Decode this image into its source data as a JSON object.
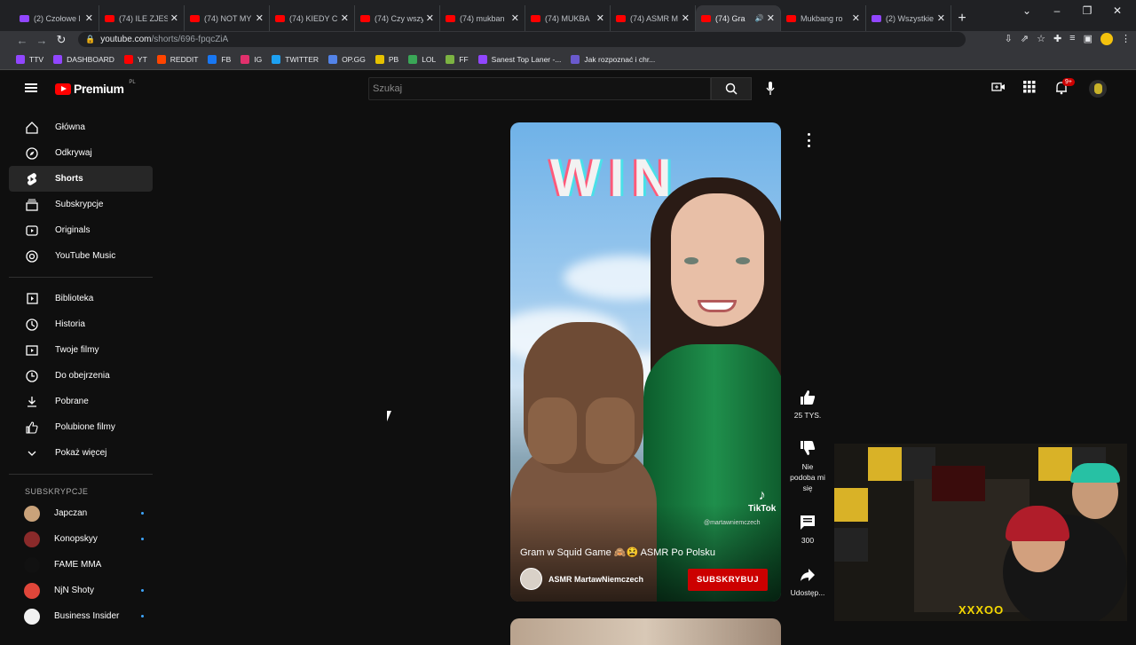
{
  "browser": {
    "tabs": [
      {
        "title": "(2) Czołowe l",
        "type": "tw"
      },
      {
        "title": "(74) ILE ZJESZ",
        "type": "yt"
      },
      {
        "title": "(74) NOT MY",
        "type": "yt"
      },
      {
        "title": "(74) KIEDY C",
        "type": "yt"
      },
      {
        "title": "(74) Czy wszy",
        "type": "yt"
      },
      {
        "title": "(74) mukban",
        "type": "yt"
      },
      {
        "title": "(74) MUKBA",
        "type": "yt"
      },
      {
        "title": "(74) ASMR M",
        "type": "yt"
      },
      {
        "title": "(74) Gra",
        "type": "yt",
        "active": true
      },
      {
        "title": "Mukbang ro",
        "type": "yt"
      },
      {
        "title": "(2) Wszystkie",
        "type": "tw"
      }
    ],
    "url_domain": "youtube.com",
    "url_path": "/shorts/696-fpqcZiA",
    "bookmarks": [
      {
        "label": "TTV",
        "color": "#9146ff"
      },
      {
        "label": "DASHBOARD",
        "color": "#9146ff"
      },
      {
        "label": "YT",
        "color": "#ff0000"
      },
      {
        "label": "REDDIT",
        "color": "#ff4500"
      },
      {
        "label": "FB",
        "color": "#1877f2"
      },
      {
        "label": "IG",
        "color": "#e1306c"
      },
      {
        "label": "TWITTER",
        "color": "#1da1f2"
      },
      {
        "label": "OP.GG",
        "color": "#5383e8"
      },
      {
        "label": "PB",
        "color": "#e6c200"
      },
      {
        "label": "LOL",
        "color": "#3aa757"
      },
      {
        "label": "FF",
        "color": "#7cb342"
      },
      {
        "label": "Sanest Top Laner -...",
        "color": "#9146ff"
      },
      {
        "label": "Jak rozpoznać i chr...",
        "color": "#6a5acd"
      }
    ]
  },
  "header": {
    "logo_text": "Premium",
    "logo_region": "PL",
    "search_placeholder": "Szukaj",
    "notif_count": "9+"
  },
  "sidebar": {
    "items": [
      {
        "label": "Główna",
        "icon": "home-icon"
      },
      {
        "label": "Odkrywaj",
        "icon": "compass-icon"
      },
      {
        "label": "Shorts",
        "icon": "shorts-icon",
        "active": true
      },
      {
        "label": "Subskrypcje",
        "icon": "subscriptions-icon"
      },
      {
        "label": "Originals",
        "icon": "originals-icon"
      },
      {
        "label": "YouTube Music",
        "icon": "music-icon"
      }
    ],
    "library": [
      {
        "label": "Biblioteka",
        "icon": "library-icon"
      },
      {
        "label": "Historia",
        "icon": "history-icon"
      },
      {
        "label": "Twoje filmy",
        "icon": "your-videos-icon"
      },
      {
        "label": "Do obejrzenia",
        "icon": "watch-later-icon"
      },
      {
        "label": "Pobrane",
        "icon": "download-icon"
      },
      {
        "label": "Polubione filmy",
        "icon": "like-icon"
      },
      {
        "label": "Pokaż więcej",
        "icon": "chevron-down-icon"
      }
    ],
    "subs_heading": "SUBSKRYPCJE",
    "subscriptions": [
      {
        "label": "Japczan",
        "color": "#c9a27a",
        "dot": true
      },
      {
        "label": "Konopskyy",
        "color": "#8a2a2a",
        "dot": true
      },
      {
        "label": "FAME MMA",
        "color": "#111111",
        "dot": false
      },
      {
        "label": "NjN Shoty",
        "color": "#e0463a",
        "dot": true
      },
      {
        "label": "Business Insider",
        "color": "#f2f2f2",
        "dot": true
      }
    ]
  },
  "short": {
    "overlay_text": "WIN",
    "title": "Gram w Squid Game 🙈😫 ASMR Po Polsku",
    "channel": "ASMR MartawNiemczech",
    "subscribe_label": "SUBSKRYBUJ",
    "watermark": "TikTok",
    "watermark_handle": "@martawniemczech"
  },
  "actions": {
    "likes": "25 TYS.",
    "dislike_label": "Nie podoba mi się",
    "comments": "300",
    "share_label": "Udostęp..."
  },
  "overlay": {
    "webcam_logo": "XXXOO"
  }
}
